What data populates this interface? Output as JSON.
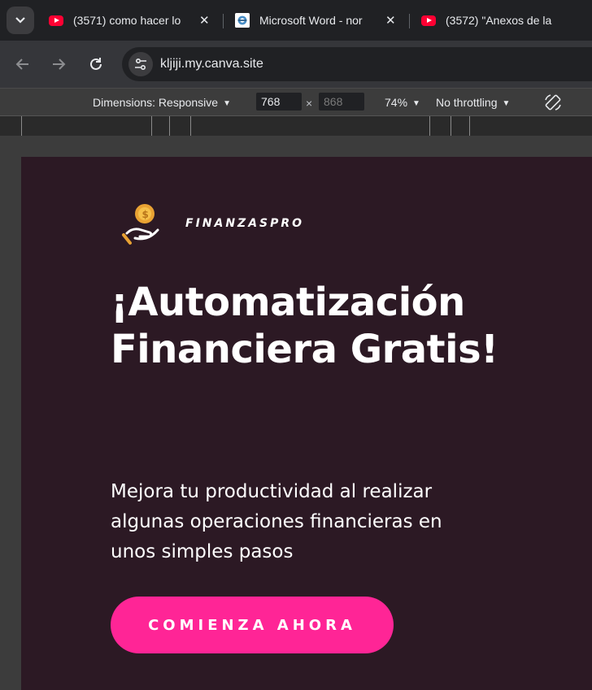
{
  "tabs": [
    {
      "title": "(3571) como hacer lo",
      "icon": "youtube-icon"
    },
    {
      "title": "Microsoft Word - nor",
      "icon": "document-favicon-icon"
    },
    {
      "title": "(3572) \"Anexos de la",
      "icon": "youtube-icon"
    }
  ],
  "toolbar": {
    "url": "kljiji.my.canva.site"
  },
  "device_toolbar": {
    "dimensions_label": "Dimensions: Responsive",
    "width_value": "768",
    "height_value": "868",
    "times": "×",
    "zoom": "74%",
    "throttling": "No throttling"
  },
  "page": {
    "brand_name": "FINANZASPRO",
    "title": "¡Automatización Financiera Gratis!",
    "subtitle": "Mejora tu productividad al realizar algunas operaciones financieras en unos simples pasos",
    "cta_label": "COMIENZA AHORA"
  },
  "colors": {
    "page_background": "#2c1924",
    "cta": "#ff2596",
    "youtube": "#ff0033"
  }
}
